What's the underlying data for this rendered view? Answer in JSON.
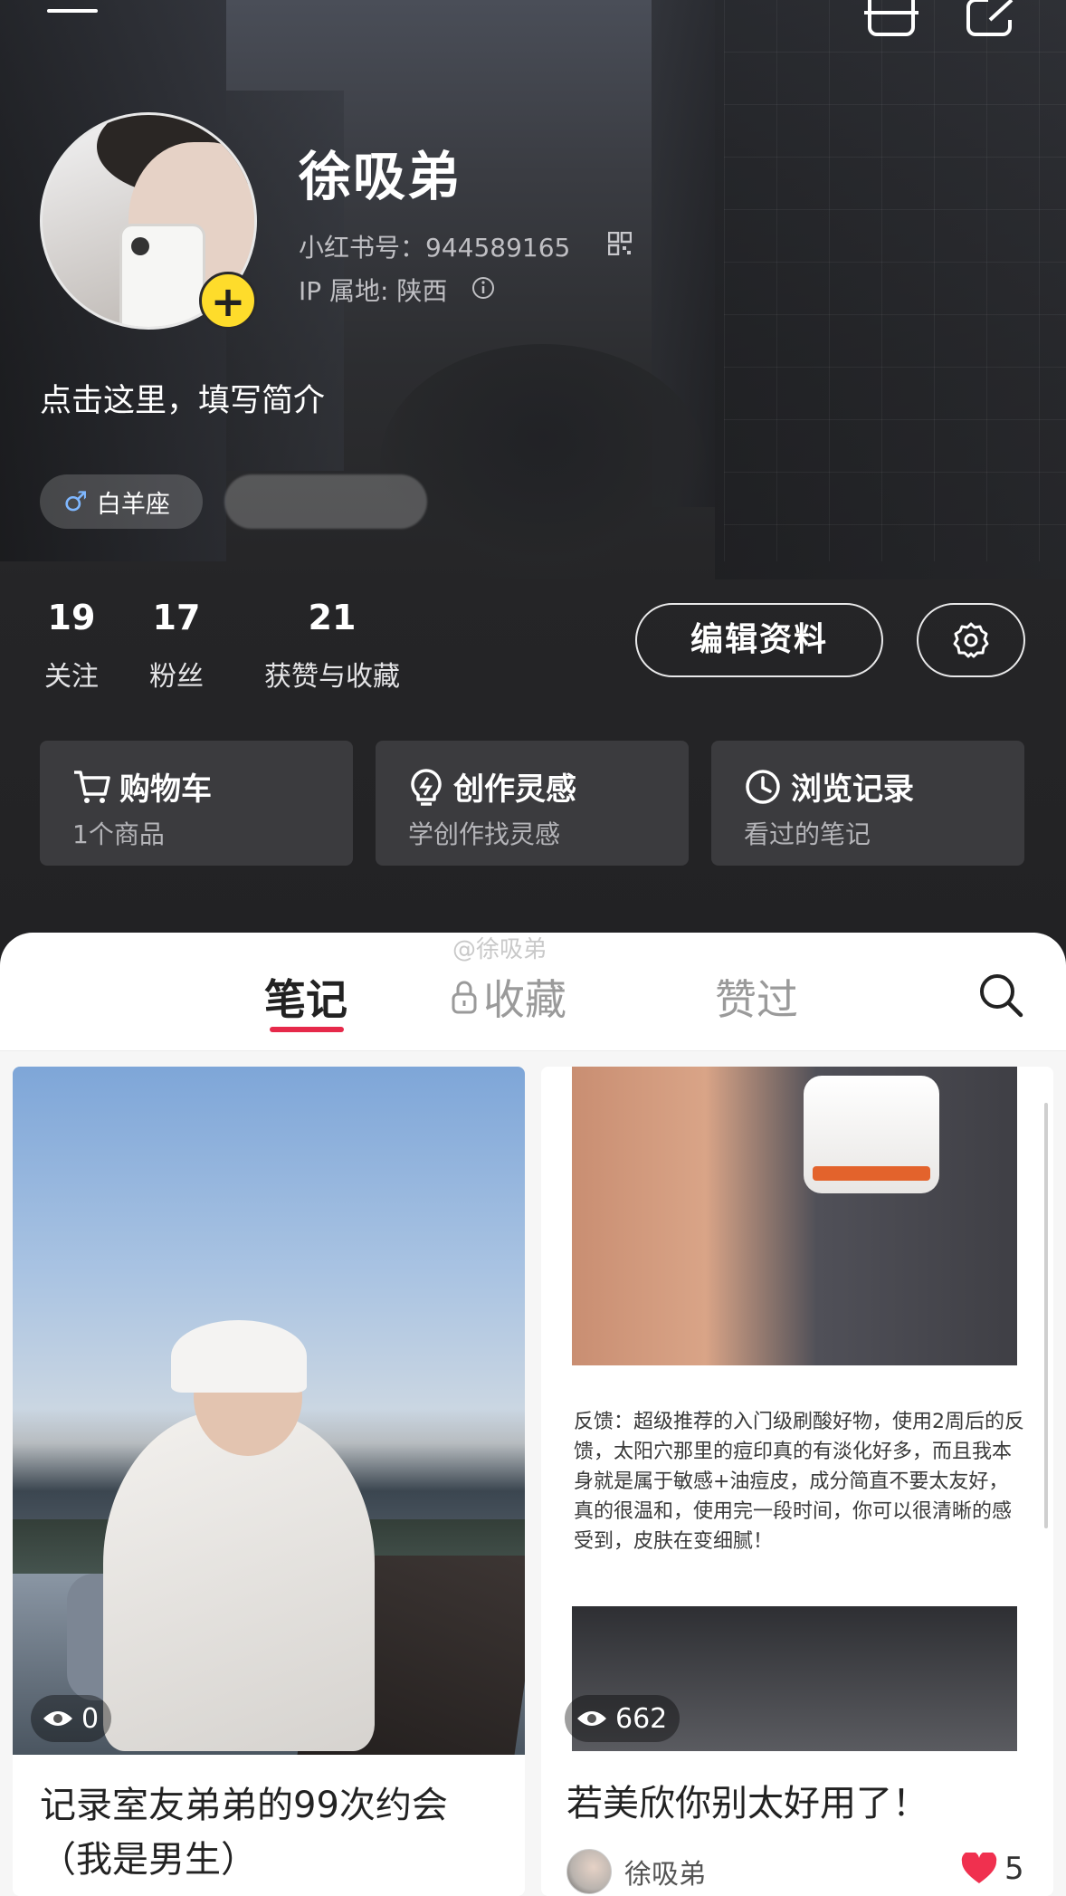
{
  "profile": {
    "username": "徐吸弟",
    "id_line": "小红书号：944589165",
    "ip_line": "IP 属地: 陕西",
    "bio": "点击这里，填写简介",
    "tags": {
      "gender_symbol": "♂",
      "zodiac": "白羊座"
    },
    "avatar_add": "+"
  },
  "stats": {
    "following": {
      "value": "19",
      "label": "关注"
    },
    "fans": {
      "value": "17",
      "label": "粉丝"
    },
    "likes": {
      "value": "21",
      "label": "获赞与收藏"
    }
  },
  "actions": {
    "edit_label": "编辑资料"
  },
  "cards": {
    "cart": {
      "title": "购物车",
      "sub": "1个商品"
    },
    "inspire": {
      "title": "创作灵感",
      "sub": "学创作找灵感"
    },
    "history": {
      "title": "浏览记录",
      "sub": "看过的笔记"
    }
  },
  "watermark": "@徐吸弟",
  "tabs": {
    "notes": "笔记",
    "collect": "收藏",
    "liked": "赞过"
  },
  "notes": [
    {
      "views": "0",
      "title": "记录室友弟弟的99次约会（我是男生）"
    },
    {
      "views": "662",
      "title": "若美欣你别太好用了！",
      "image_text": "反馈：超级推荐的入门级刷酸好物，使用2周后的反馈，太阳穴那里的痘印真的有淡化好多，而且我本身就是属于敏感+油痘皮，成分简直不要太友好，真的很温和，使用完一段时间，你可以很清晰的感受到，皮肤在变细腻！",
      "author": "徐吸弟",
      "likes": "5"
    }
  ],
  "colors": {
    "accent": "#e6294a",
    "add_badge": "#fedc2b",
    "like_heart": "#f0304f"
  },
  "icons": [
    "menu-icon",
    "scan-icon",
    "share-icon",
    "qr-code-icon",
    "info-icon",
    "gear-icon",
    "cart-icon",
    "bulb-icon",
    "clock-icon",
    "lock-icon",
    "search-icon",
    "eye-icon",
    "heart-icon"
  ]
}
